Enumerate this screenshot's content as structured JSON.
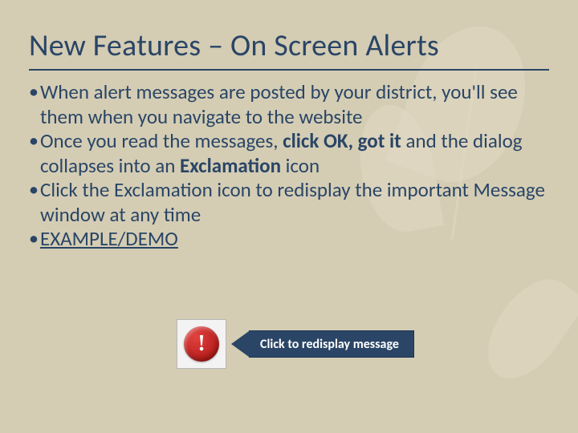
{
  "title": "New Features – On Screen Alerts",
  "bullets": {
    "b0": "When alert messages are posted by your district, you'll see them when you navigate to the website",
    "b1_pre": "Once you read the messages, ",
    "b1_bold1": "click OK, got it",
    "b1_mid": " and the dialog collapses into an ",
    "b1_bold2": "Exclamation",
    "b1_post": " icon",
    "b2": "Click the Exclamation icon to redisplay the important Message window at any time",
    "b3": "EXAMPLE/DEMO"
  },
  "alert_glyph": "!",
  "callout": "Click to redisplay message"
}
